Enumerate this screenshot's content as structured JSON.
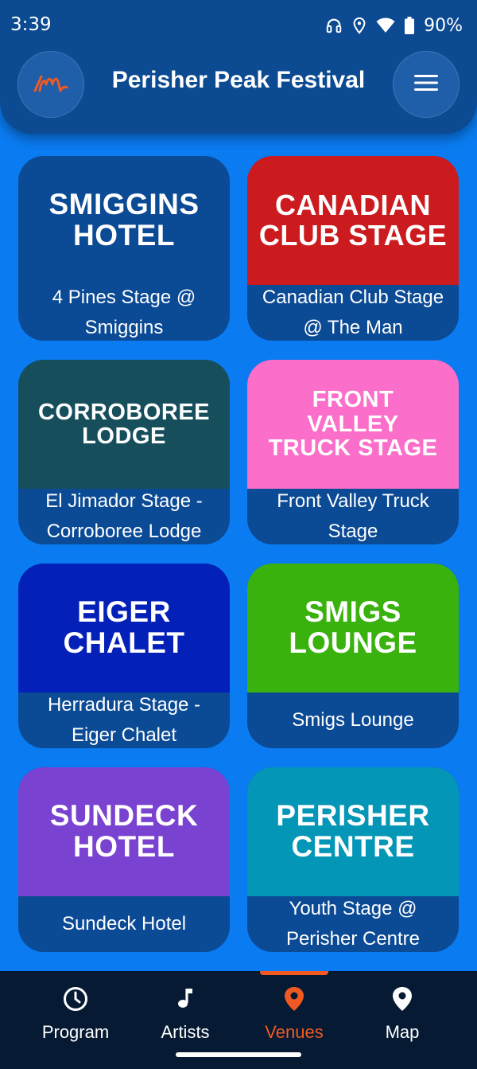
{
  "status_bar": {
    "time": "3:39",
    "battery": "90%",
    "icons": [
      "headphones-icon",
      "location-icon",
      "wifi-icon",
      "battery-icon"
    ]
  },
  "header": {
    "title": "Perisher Peak Festival",
    "logo_icon": "festival-logo-icon",
    "menu_icon": "hamburger-menu-icon"
  },
  "colors": {
    "background": "#0a7bf0",
    "header": "#0c4a92",
    "card_bottom": "#0b4a95",
    "nav_background": "#061a34",
    "accent": "#f05a22"
  },
  "venues": [
    {
      "name_lines": [
        "SMIGGINS",
        "HOTEL"
      ],
      "stage_lines": [
        "4 Pines Stage @",
        "Smiggins"
      ],
      "color": "#0b4a95"
    },
    {
      "name_lines": [
        "CANADIAN",
        "CLUB STAGE"
      ],
      "stage_lines": [
        "Canadian Club Stage",
        "@ The Man"
      ],
      "color": "#cc1b1f"
    },
    {
      "name_lines": [
        "CORROBOREE",
        "LODGE"
      ],
      "stage_lines": [
        "El Jimador Stage -",
        "Corroboree Lodge"
      ],
      "color": "#164e5c"
    },
    {
      "name_lines": [
        "FRONT",
        "VALLEY",
        "TRUCK STAGE"
      ],
      "stage_lines": [
        "Front Valley Truck",
        "Stage"
      ],
      "color": "#fb6ec9"
    },
    {
      "name_lines": [
        "EIGER",
        "CHALET"
      ],
      "stage_lines": [
        "Herradura Stage -",
        "Eiger Chalet"
      ],
      "color": "#0321b8"
    },
    {
      "name_lines": [
        "SMIGS",
        "LOUNGE"
      ],
      "stage_lines": [
        "Smigs Lounge"
      ],
      "color": "#3ab20e"
    },
    {
      "name_lines": [
        "SUNDECK",
        "HOTEL"
      ],
      "stage_lines": [
        "Sundeck Hotel"
      ],
      "color": "#7a42d0"
    },
    {
      "name_lines": [
        "PERISHER",
        "CENTRE"
      ],
      "stage_lines": [
        "Youth Stage @",
        "Perisher Centre"
      ],
      "color": "#0496b6"
    }
  ],
  "nav": [
    {
      "label": "Program",
      "icon": "clock-icon",
      "active": false
    },
    {
      "label": "Artists",
      "icon": "music-note-icon",
      "active": false
    },
    {
      "label": "Venues",
      "icon": "location-pin-icon",
      "active": true
    },
    {
      "label": "Map",
      "icon": "map-pin-icon",
      "active": false
    }
  ]
}
